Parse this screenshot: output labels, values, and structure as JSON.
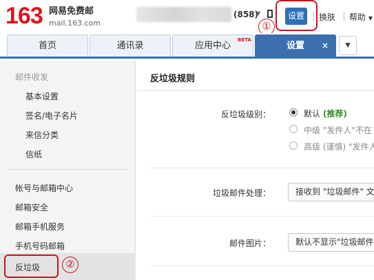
{
  "header": {
    "logo_number": "163",
    "logo_name": "网易免费邮",
    "logo_domain": "mail.163.com",
    "unread_count": "(858)",
    "settings_label": "设置",
    "skin_label": "换肤",
    "help_label": "帮助",
    "marker_1": "①"
  },
  "tabs": {
    "home": "首页",
    "contacts": "通讯录",
    "apps": "应用中心",
    "apps_badge": "BETA",
    "settings": "设置",
    "close": "×",
    "more": "▼"
  },
  "sidebar": {
    "section_title": "邮件收发",
    "sub_items": [
      "基本设置",
      "签名/电子名片",
      "来信分类",
      "信纸"
    ],
    "items": [
      "帐号与邮箱中心",
      "邮箱安全",
      "邮箱手机服务",
      "手机号码邮箱"
    ],
    "active_item": "反垃圾",
    "marker_2": "②"
  },
  "main": {
    "title": "反垃圾规则",
    "level_label": "反垃圾级别：",
    "level_options": [
      {
        "text": "默认",
        "suffix": "(推荐)",
        "selected": true
      },
      {
        "text": "中级 \"发件人\"不在"
      },
      {
        "text": "高级 (谨慎) \"发件人"
      }
    ],
    "spam_label": "垃圾邮件处理：",
    "spam_value": "接收到 \"垃圾邮件\" 文",
    "image_label": "邮件图片：",
    "image_value": "默认不显示\"垃圾邮件"
  },
  "colors": {
    "brand_red": "#d8161c",
    "tab_blue": "#3d6fae",
    "callout_red": "#c8141b",
    "recommend_green": "#3a8a2e"
  }
}
